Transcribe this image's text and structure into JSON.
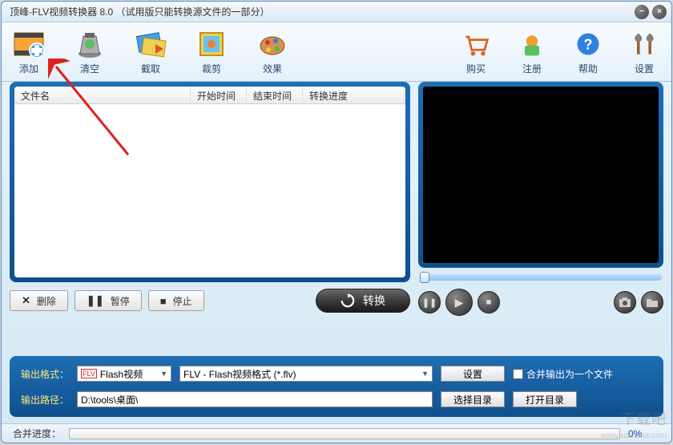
{
  "title": "顶峰-FLV视频转换器 8.0 （试用版只能转换源文件的一部分）",
  "toolbar": {
    "left": [
      {
        "id": "add",
        "label": "添加"
      },
      {
        "id": "clear",
        "label": "清空"
      },
      {
        "id": "capture",
        "label": "截取"
      },
      {
        "id": "crop",
        "label": "裁剪"
      },
      {
        "id": "effect",
        "label": "效果"
      }
    ],
    "right": [
      {
        "id": "buy",
        "label": "购买"
      },
      {
        "id": "register",
        "label": "注册"
      },
      {
        "id": "help",
        "label": "帮助"
      },
      {
        "id": "settings",
        "label": "设置"
      }
    ]
  },
  "list": {
    "headers": {
      "name": "文件名",
      "start": "开始时间",
      "end": "结束时间",
      "progress": "转换进度"
    }
  },
  "controls": {
    "delete": "删除",
    "pause": "暂停",
    "stop": "停止",
    "convert": "转换"
  },
  "form": {
    "format_label": "输出格式：",
    "format_type": "Flash视频",
    "format_ext": "FLV - Flash视频格式 (*.flv)",
    "settings_btn": "设置",
    "merge_checkbox": "合并输出为一个文件",
    "path_label": "输出路径：",
    "path_value": "D:\\tools\\桌面\\",
    "choose_dir": "选择目录",
    "open_dir": "打开目录"
  },
  "status": {
    "label": "合并进度：",
    "percent": "0%"
  },
  "watermark": {
    "main": "下载吧",
    "sub": "www.xiazaiba.com"
  }
}
